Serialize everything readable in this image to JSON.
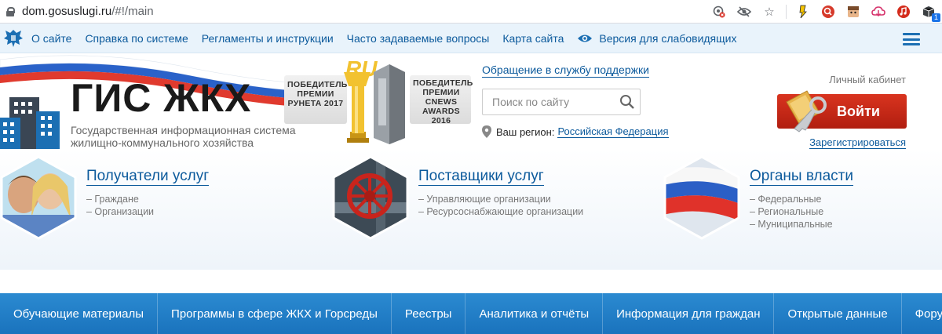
{
  "browser": {
    "url_host": "dom.gosuslugi.ru",
    "url_path": "/#!/main",
    "extension_badge": "1"
  },
  "topnav": {
    "items": [
      "О сайте",
      "Справка по системе",
      "Регламенты и инструкции",
      "Часто задаваемые вопросы",
      "Карта сайта"
    ],
    "accessibility_label": "Версия для слабовидящих"
  },
  "header": {
    "logo_title": "ГИС ЖКХ",
    "logo_subtitle_line1": "Государственная информационная система",
    "logo_subtitle_line2": "жилищно-коммунального хозяйства",
    "award_left": [
      "ПОБЕДИТЕЛЬ",
      "ПРЕМИИ",
      "РУНЕТА 2017"
    ],
    "award_ru": "RU",
    "award_right": [
      "ПОБЕДИТЕЛЬ",
      "ПРЕМИИ",
      "CNEWS",
      "AWARDS 2016"
    ],
    "support_link": "Обращение в службу поддержки",
    "search_placeholder": "Поиск по сайту",
    "region_label": "Ваш регион:",
    "region_value": "Российская Федерация",
    "cabinet_label": "Личный кабинет",
    "login_label": "Войти",
    "register_link": "Зарегистрироваться"
  },
  "categories": [
    {
      "title": "Получатели услуг",
      "items": [
        "– Граждане",
        "– Организации"
      ]
    },
    {
      "title": "Поставщики услуг",
      "items": [
        "– Управляющие организации",
        "– Ресурсоснабжающие организации"
      ]
    },
    {
      "title": "Органы власти",
      "items": [
        "– Федеральные",
        "– Региональные",
        "– Муниципальные"
      ]
    }
  ],
  "bottomnav": [
    "Обучающие материалы",
    "Программы в сфере ЖКХ и Горсреды",
    "Реестры",
    "Аналитика и отчёты",
    "Информация для граждан",
    "Открытые данные",
    "Форум"
  ],
  "colors": {
    "link": "#0c5a9c",
    "bottom_nav": "#1f7cc4",
    "login_button": "#c4281a"
  }
}
